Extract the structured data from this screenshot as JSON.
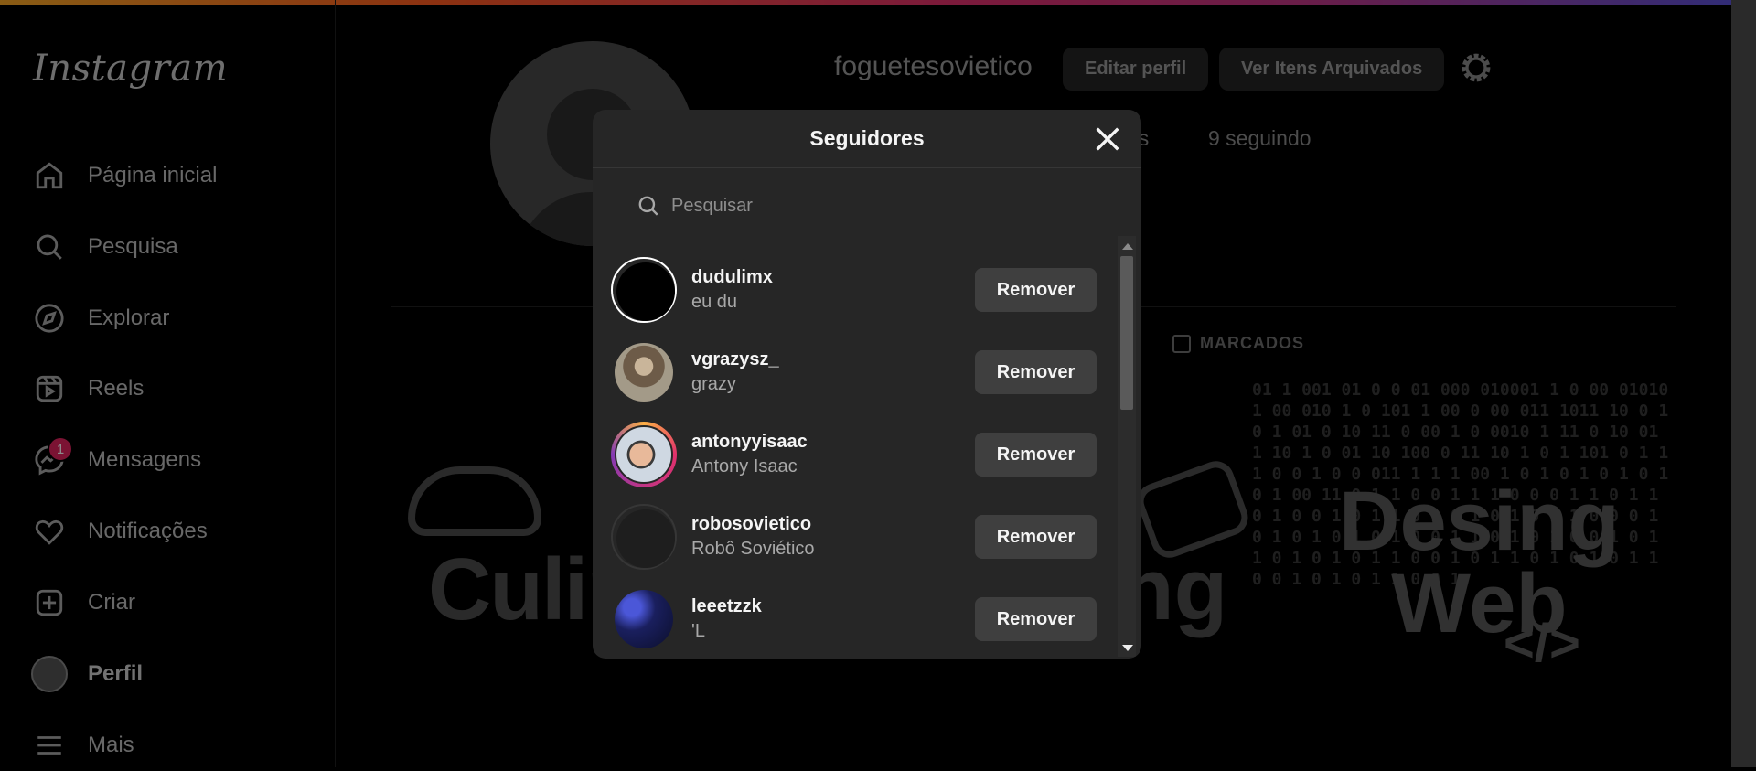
{
  "sidebar": {
    "logo": "Instagram",
    "items": [
      {
        "label": "Página inicial",
        "icon": "home-icon"
      },
      {
        "label": "Pesquisa",
        "icon": "search-icon"
      },
      {
        "label": "Explorar",
        "icon": "compass-icon"
      },
      {
        "label": "Reels",
        "icon": "reels-icon"
      },
      {
        "label": "Mensagens",
        "icon": "messenger-icon",
        "badge": "1"
      },
      {
        "label": "Notificações",
        "icon": "heart-icon"
      },
      {
        "label": "Criar",
        "icon": "plus-square-icon"
      },
      {
        "label": "Perfil",
        "icon": "avatar"
      },
      {
        "label": "Mais",
        "icon": "menu-icon"
      }
    ]
  },
  "profile": {
    "username": "foguetesovietico",
    "edit_label": "Editar perfil",
    "archive_label": "Ver Itens Arquivados",
    "stat_partial": "es",
    "following": "9 seguindo",
    "tab_tagged": "MARCADOS"
  },
  "posts": {
    "post1_text": "Culin",
    "post2_text": "ng",
    "post3_line1": "Desing",
    "post3_line2": "Web",
    "post3_code": "</>",
    "binary": "01 1 001 01 0 0 01 000 010001 1 0 00 01010 1 00 010 1 0 101 1 00 0 00 011 1011 10 0 1 0 1 01 0 10 11 0 00 1 0 0010 1 11 0 10 01 1 10 1 0 01 10 100 0 11 10 1 0 1 101 0 1 1 1 0 0 1 0 0 011 1 1 1 00 1 0 1 0 1 0 1 0 1 0 1 00 11 0 1 1 0 0 1 1 1 0 0 0 1 1 0 1 1 0 1 0 0 1 0 1 1 0 1 0 1 0 1 0 1 1 0 0 0 1 0 1 0 1 0 1 0 1 0 0 1 1 0 1 0 1 0 0 1 0 1 1 0 1 0 1 0 1 1 0 0 1 0 1 1 0 1 0 1 0 1 1 0 0 1 0 1 0 1 1 0 0 1"
  },
  "modal": {
    "title": "Seguidores",
    "search_placeholder": "Pesquisar",
    "remove_label": "Remover",
    "followers": [
      {
        "username": "dudulimx",
        "name": "eu du",
        "ring": "#ffffff",
        "fill": "#000000"
      },
      {
        "username": "vgrazysz_",
        "name": "grazy",
        "ring": "#262626",
        "fill": "#8a7a6a"
      },
      {
        "username": "antonyyisaac",
        "name": "Antony Isaac",
        "ring": "#d62976",
        "fill": "#b9c7d6"
      },
      {
        "username": "robosovietico",
        "name": "Robô Soviético",
        "ring": "#363636",
        "fill": "#1e1e1e"
      },
      {
        "username": "leeetzzk",
        "name": "'L",
        "ring": "#262626",
        "fill": "#1b1f6b"
      },
      {
        "username": "",
        "name": "",
        "ring": "#d62976",
        "fill": "#5a2a4a"
      }
    ]
  }
}
